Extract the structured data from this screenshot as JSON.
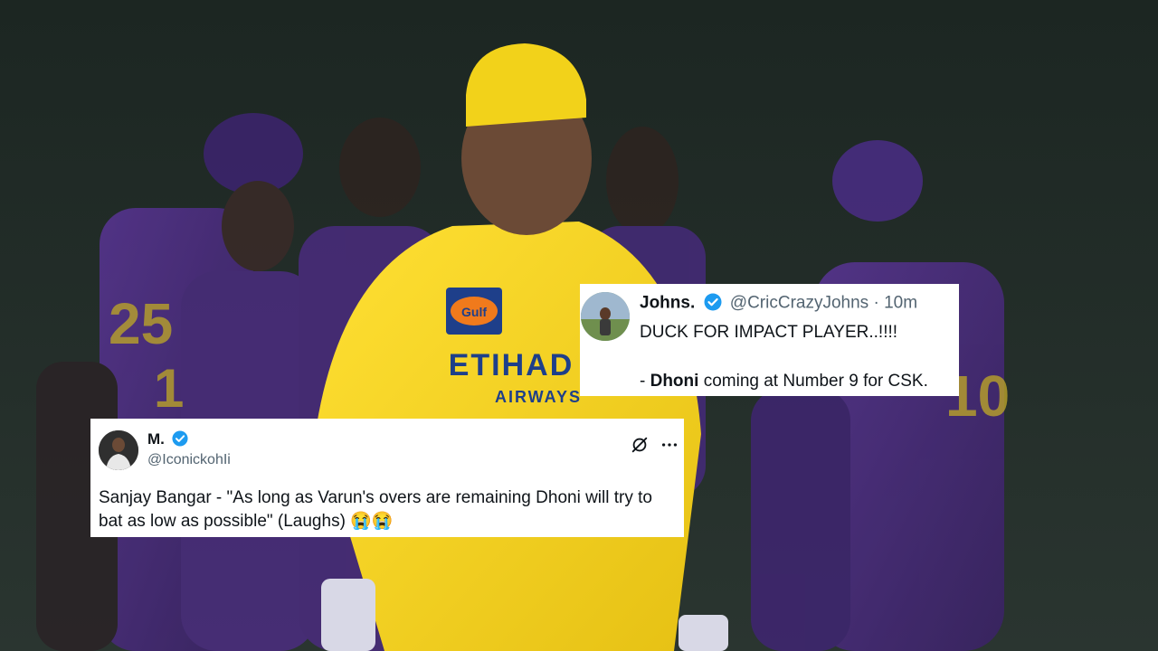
{
  "scene": {
    "description_colors": {
      "background": "#1f2a24",
      "kkr_purple": "#4a2a7a",
      "csk_yellow": "#f3d21c"
    },
    "jersey_text": "ETIHAD AIRWAYS",
    "cap_sponsor": "Gulf"
  },
  "tweet_top": {
    "name": "Johns.",
    "handle": "@CricCrazyJohns",
    "separator": "·",
    "time": "10m",
    "line1": "DUCK FOR IMPACT PLAYER..!!!!",
    "line2_bold": "Dhoni",
    "line2_rest": " coming at Number 9 for CSK.",
    "line2_prefix": "- ",
    "verified_color": "#1d9bf0"
  },
  "tweet_bottom": {
    "name": "M.",
    "handle": "@IconickohIi",
    "text": "Sanjay Bangar - \"As long as Varun's overs are remaining Dhoni will try to bat as low as possible\" (Laughs) 😭😭",
    "more_icon": "more-icon",
    "grok_icon": "grok-icon",
    "verified_color": "#1d9bf0"
  }
}
